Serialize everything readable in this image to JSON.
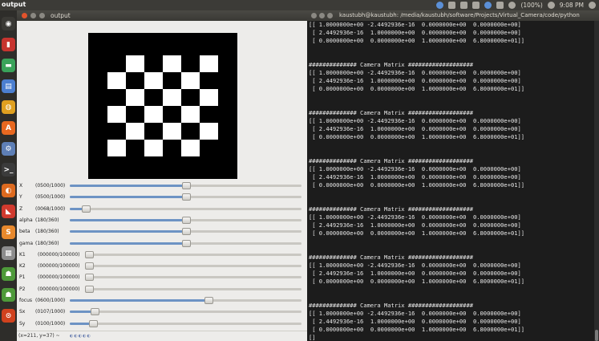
{
  "top_panel": {
    "app_title": "output",
    "battery": "(100%)",
    "clock": "9:08 PM",
    "colors": {
      "panel": "#3c3b37",
      "launcher": "#2e2d2a"
    }
  },
  "launcher": {
    "items": [
      {
        "icon": "dash-icon",
        "color": "#3a3935",
        "glyph": "◉"
      },
      {
        "icon": "red-app-icon",
        "color": "#c7342f",
        "glyph": "▮"
      },
      {
        "icon": "green-app-icon",
        "color": "#3aa35a",
        "glyph": "▬"
      },
      {
        "icon": "blue-app-icon",
        "color": "#4c7fd0",
        "glyph": "▤"
      },
      {
        "icon": "chrome-icon",
        "color": "#e0a020",
        "glyph": "◍"
      },
      {
        "icon": "software-center-icon",
        "color": "#e86820",
        "glyph": "A"
      },
      {
        "icon": "settings-icon",
        "color": "#5e7fb6",
        "glyph": "⚙"
      },
      {
        "icon": "terminal-icon",
        "color": "#3b3b3b",
        "glyph": ">_"
      },
      {
        "icon": "firefox-icon",
        "color": "#dd6a1f",
        "glyph": "◐"
      },
      {
        "icon": "red-tool-icon",
        "color": "#d03a2e",
        "glyph": "◣"
      },
      {
        "icon": "orange-app-icon",
        "color": "#e8892d",
        "glyph": "S"
      },
      {
        "icon": "grey-app-icon",
        "color": "#8c8c8c",
        "glyph": "▦"
      },
      {
        "icon": "green-robot-icon",
        "color": "#4e9a3a",
        "glyph": "☗"
      },
      {
        "icon": "green-robot-icon-2",
        "color": "#4e9a3a",
        "glyph": "☗"
      },
      {
        "icon": "trash-icon",
        "color": "#d0421e",
        "glyph": "⊙"
      }
    ]
  },
  "output_window": {
    "title": "output",
    "sliders": [
      {
        "label": "X",
        "value_text": "(0500/1000)",
        "fraction": 0.5
      },
      {
        "label": "Y",
        "value_text": "(0500/1000)",
        "fraction": 0.5
      },
      {
        "label": "Z",
        "value_text": "(0068/1000)",
        "fraction": 0.068
      },
      {
        "label": "alpha",
        "value_text": "(180/360)",
        "fraction": 0.5
      },
      {
        "label": "beta",
        "value_text": "(180/360)",
        "fraction": 0.5
      },
      {
        "label": "gama",
        "value_text": "(180/360)",
        "fraction": 0.5
      },
      {
        "label": "K1",
        "value_text": "(000000/100000)",
        "fraction": 0.0
      },
      {
        "label": "K2",
        "value_text": "(000000/100000)",
        "fraction": 0.0
      },
      {
        "label": "P1",
        "value_text": "(000000/100000)",
        "fraction": 0.0
      },
      {
        "label": "P2",
        "value_text": "(000000/100000)",
        "fraction": 0.0
      },
      {
        "label": "focus",
        "value_text": "(0600/1000)",
        "fraction": 0.6
      },
      {
        "label": "Sx",
        "value_text": "(0107/1000)",
        "fraction": 0.107
      },
      {
        "label": "Sy",
        "value_text": "(0100/1000)",
        "fraction": 0.1
      }
    ],
    "status_text": "(x=211, y=37) ~",
    "status_icons": "◐◐◐◐◐"
  },
  "terminal": {
    "title": "kaustubh@kaustubh: /media/kaustubh/software/Projects/Virtual_Camera/code/python",
    "lines": [
      "[[ 1.0000000e+00 -2.4492936e-16  0.0000000e+00  0.0000000e+00]",
      " [ 2.4492936e-16  1.0000000e+00  0.0000000e+00  0.0000000e+00]",
      " [ 0.0000000e+00  0.0000000e+00  1.0000000e+00  6.8000000e+01]]",
      "",
      "",
      "############## Camera Matrix ###################",
      "[[ 1.0000000e+00 -2.4492936e-16  0.0000000e+00  0.0000000e+00]",
      " [ 2.4492936e-16  1.0000000e+00  0.0000000e+00  0.0000000e+00]",
      " [ 0.0000000e+00  0.0000000e+00  1.0000000e+00  6.8000000e+01]]",
      "",
      "",
      "############## Camera Matrix ###################",
      "[[ 1.0000000e+00 -2.4492936e-16  0.0000000e+00  0.0000000e+00]",
      " [ 2.4492936e-16  1.0000000e+00  0.0000000e+00  0.0000000e+00]",
      " [ 0.0000000e+00  0.0000000e+00  1.0000000e+00  6.8000000e+01]]",
      "",
      "",
      "############## Camera Matrix ###################",
      "[[ 1.0000000e+00 -2.4492936e-16  0.0000000e+00  0.0000000e+00]",
      " [ 2.4492936e-16  1.0000000e+00  0.0000000e+00  0.0000000e+00]",
      " [ 0.0000000e+00  0.0000000e+00  1.0000000e+00  6.8000000e+01]]",
      "",
      "",
      "############## Camera Matrix ###################",
      "[[ 1.0000000e+00 -2.4492936e-16  0.0000000e+00  0.0000000e+00]",
      " [ 2.4492936e-16  1.0000000e+00  0.0000000e+00  0.0000000e+00]",
      " [ 0.0000000e+00  0.0000000e+00  1.0000000e+00  6.8000000e+01]]",
      "",
      "",
      "############## Camera Matrix ###################",
      "[[ 1.0000000e+00 -2.4492936e-16  0.0000000e+00  0.0000000e+00]",
      " [ 2.4492936e-16  1.0000000e+00  0.0000000e+00  0.0000000e+00]",
      " [ 0.0000000e+00  0.0000000e+00  1.0000000e+00  6.8000000e+01]]",
      "",
      "",
      "############## Camera Matrix ###################",
      "[[ 1.0000000e+00 -2.4492936e-16  0.0000000e+00  0.0000000e+00]",
      " [ 2.4492936e-16  1.0000000e+00  0.0000000e+00  0.0000000e+00]",
      " [ 0.0000000e+00  0.0000000e+00  1.0000000e+00  6.8000000e+01]]",
      "[]"
    ],
    "colors": {
      "background": "#1c1c1c",
      "text": "#e6e6e6"
    }
  }
}
